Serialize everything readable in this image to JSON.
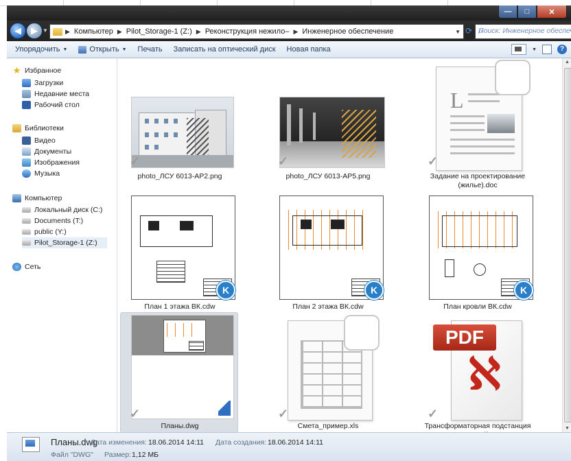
{
  "address": {
    "crumbs": [
      "Компьютер",
      "Pilot_Storage-1 (Z:)",
      "Реконструкция нежило–",
      "Инженерное обеспечение"
    ],
    "search_placeholder": "Поиск: Инженерное обеспеч..."
  },
  "toolbar": {
    "organize": "Упорядочить",
    "open": "Открыть",
    "print": "Печать",
    "burn": "Записать на оптический диск",
    "new_folder": "Новая папка"
  },
  "nav": {
    "favorites": "Избранное",
    "downloads": "Загрузки",
    "recent": "Недавние места",
    "desktop": "Рабочий стол",
    "libraries": "Библиотеки",
    "video": "Видео",
    "documents": "Документы",
    "images": "Изображения",
    "music": "Музыка",
    "computer": "Компьютер",
    "local_disk": "Локальный диск (C:)",
    "documents_t": "Documents (T:)",
    "public_y": "public (Y:)",
    "pilot_z": "Pilot_Storage-1 (Z:)",
    "network": "Сеть"
  },
  "files": [
    {
      "name": "photo_ЛСУ 6013-АР2.png"
    },
    {
      "name": "photo_ЛСУ 6013-АР5.png"
    },
    {
      "name": "Задание на проектирование (жилье).doc"
    },
    {
      "name": "План 1 этажа ВК.cdw"
    },
    {
      "name": "План 2 этажа ВК.cdw"
    },
    {
      "name": "План кровли ВК.cdw"
    },
    {
      "name": "Планы.dwg"
    },
    {
      "name": "Смета_пример.xls"
    },
    {
      "name": "Трансформаторная подстанция АР.pdf"
    }
  ],
  "icons": {
    "doc_letter": "L",
    "pdf_badge": "PDF",
    "kompas": "K"
  },
  "details": {
    "name": "Планы.dwg",
    "modified_label": "Дата изменения:",
    "modified_value": "18.06.2014 14:11",
    "created_label": "Дата создания:",
    "created_value": "18.06.2014 14:11",
    "type_label": "Файл \"DWG\"",
    "size_label": "Размер:",
    "size_value": "1,12 МБ"
  }
}
